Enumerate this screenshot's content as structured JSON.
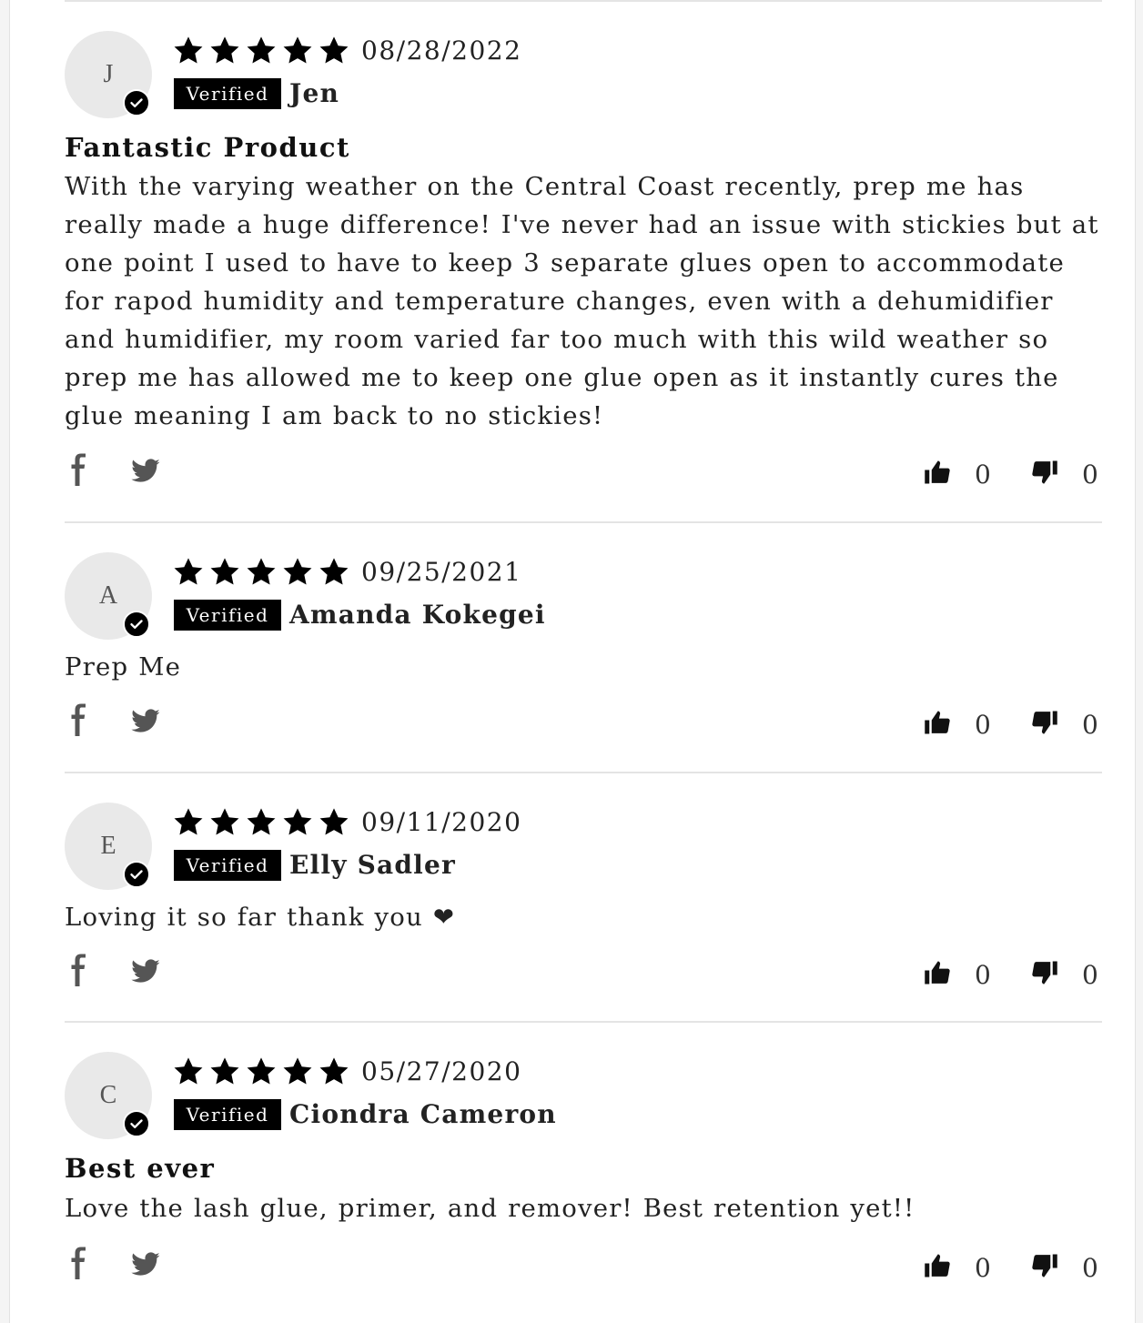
{
  "reviews": [
    {
      "initial": "J",
      "rating": 5,
      "date": "08/28/2022",
      "badge": "Verified",
      "author": "Jen",
      "title": "Fantastic Product",
      "body": "With the varying weather on the Central Coast recently, prep me has really made a huge difference! I've never had an issue with stickies but at one point I used to have to keep 3 separate glues open to accommodate for rapod humidity and temperature changes, even with a dehumidifier and humidifier, my room varied far too much with this wild weather so prep me has allowed me to keep one glue open as it instantly cures the glue meaning I am back to no stickies!",
      "upvotes": "0",
      "downvotes": "0"
    },
    {
      "initial": "A",
      "rating": 5,
      "date": "09/25/2021",
      "badge": "Verified",
      "author": "Amanda Kokegei",
      "title": "",
      "body": "Prep Me",
      "upvotes": "0",
      "downvotes": "0"
    },
    {
      "initial": "E",
      "rating": 5,
      "date": "09/11/2020",
      "badge": "Verified",
      "author": "Elly Sadler",
      "title": "",
      "body": "Loving it so far thank you ❤",
      "upvotes": "0",
      "downvotes": "0"
    },
    {
      "initial": "C",
      "rating": 5,
      "date": "05/27/2020",
      "badge": "Verified",
      "author": "Ciondra Cameron",
      "title": "Best ever",
      "body": "Love the lash glue, primer, and remover! Best retention yet!!",
      "upvotes": "0",
      "downvotes": "0"
    }
  ],
  "icons": {
    "star": "star-icon",
    "verified": "checkmark-icon",
    "facebook": "facebook-icon",
    "twitter": "twitter-icon",
    "thumbs_up": "thumbs-up-icon",
    "thumbs_down": "thumbs-down-icon"
  },
  "colors": {
    "star": "#000000",
    "badge_bg": "#000000",
    "badge_text": "#ffffff",
    "avatar_bg": "#e9e9e9",
    "divider": "#e4e4e4",
    "social_icon": "#555555"
  }
}
